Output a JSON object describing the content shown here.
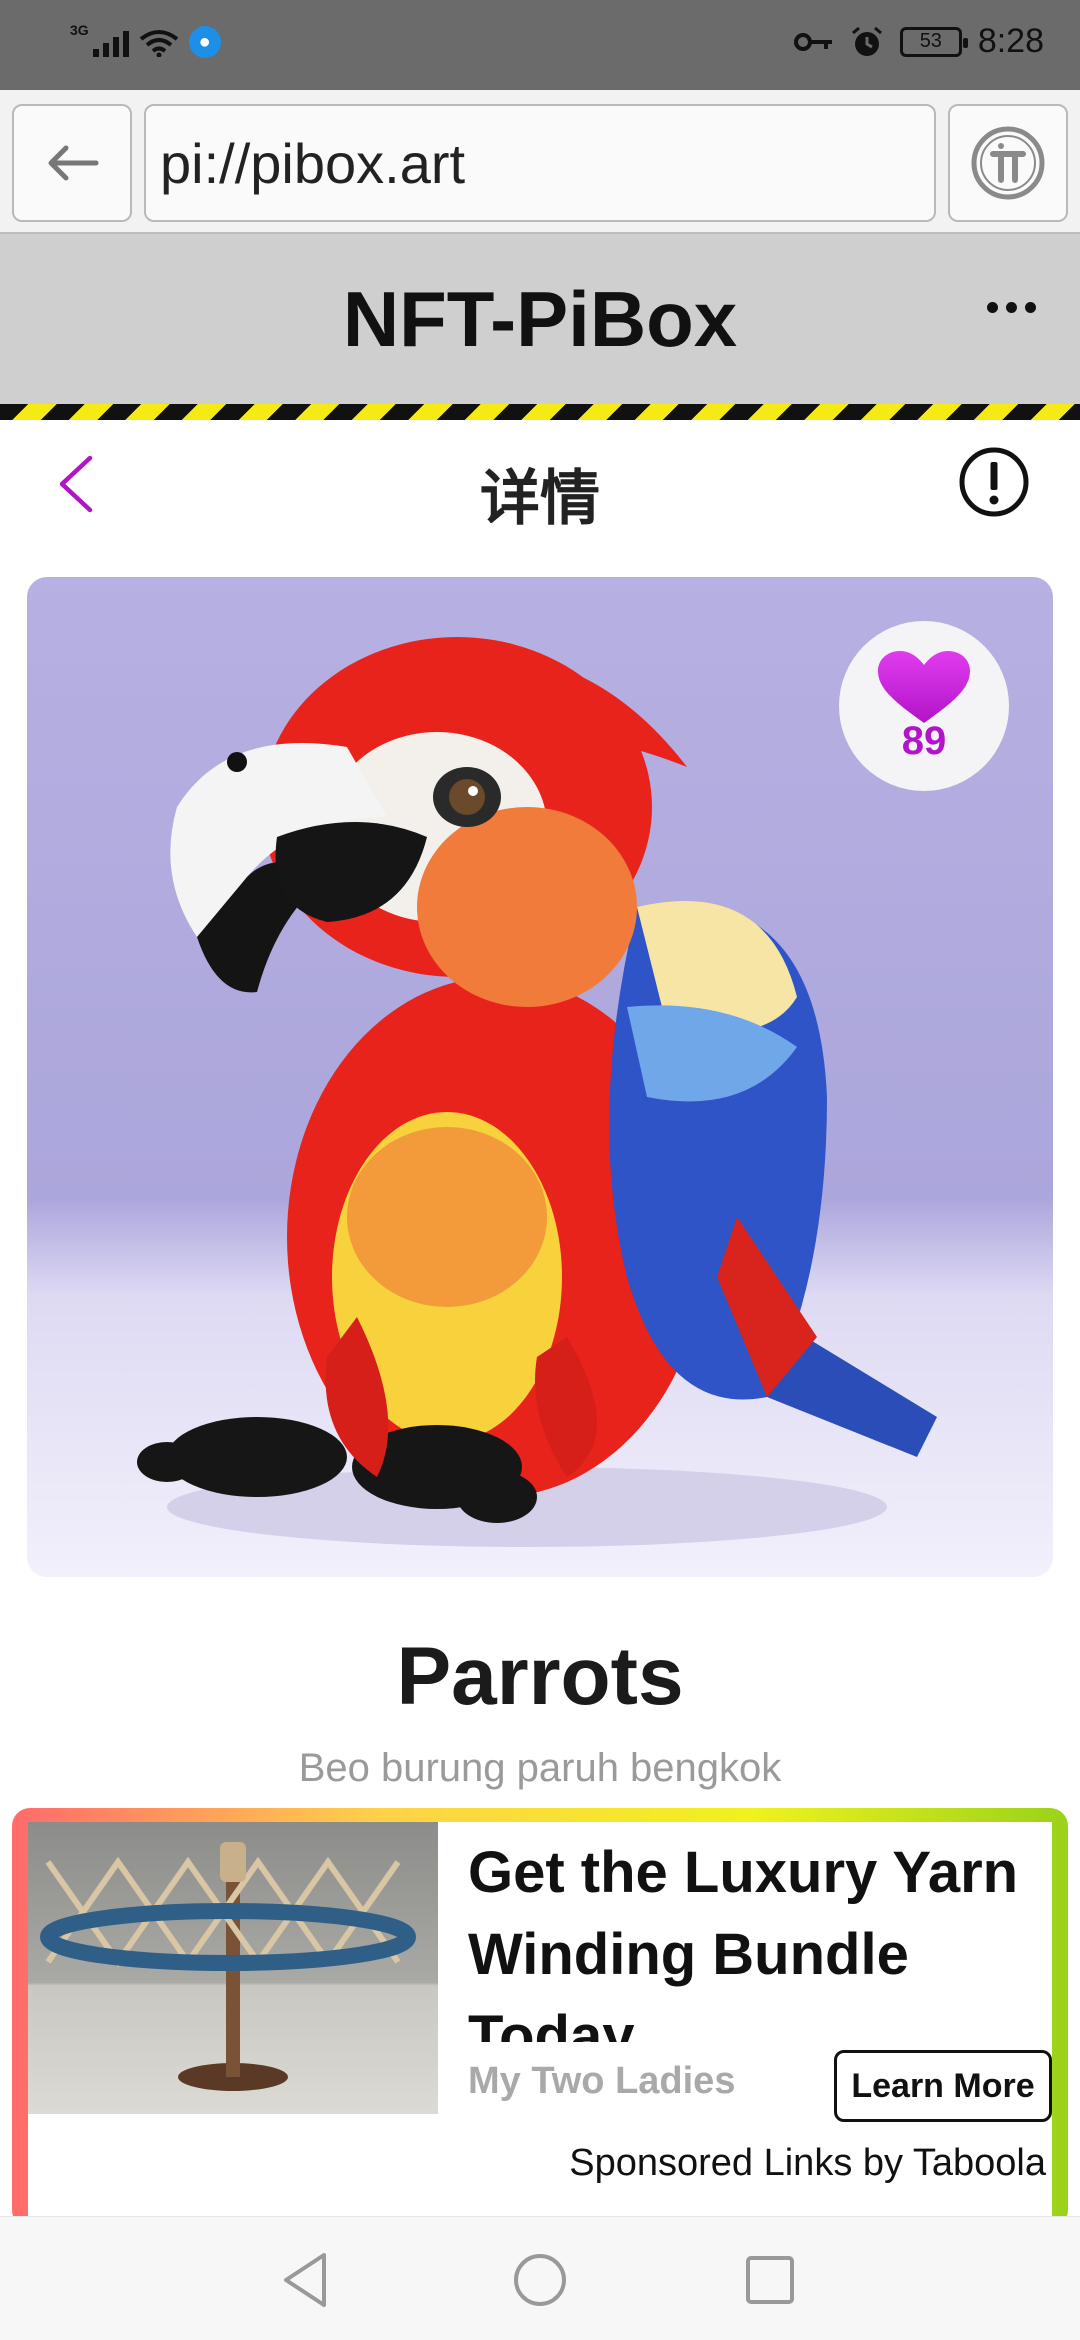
{
  "status_bar": {
    "network_type": "3G",
    "battery": "53",
    "time": "8:28",
    "icons": [
      "signal-icon",
      "wifi-icon",
      "app-notification-icon",
      "key-icon",
      "alarm-icon",
      "battery-icon"
    ]
  },
  "browser": {
    "url": "pi://pibox.art",
    "icons": [
      "back-arrow-icon",
      "pi-logo-icon"
    ]
  },
  "app_header": {
    "title": "NFT-PiBox",
    "more_icon": "more-dots-icon"
  },
  "detail": {
    "title": "详情",
    "back_icon": "chevron-left-icon",
    "info_icon": "info-icon",
    "accent_color": "#b214c8"
  },
  "nft": {
    "image": "plush-parrot-image",
    "like_count": "89",
    "like_icon": "heart-icon",
    "name": "Parrots",
    "description": "Beo burung paruh bengkok"
  },
  "ad": {
    "headline": "Get the Luxury Yarn Winding Bundle Today",
    "brand": "My Two Ladies",
    "cta": "Learn More",
    "sponsor": "Sponsored Links by Taboola",
    "image": "yarn-winder-image"
  },
  "nav_bar": {
    "icons": [
      "nav-back-icon",
      "nav-home-icon",
      "nav-recents-icon"
    ]
  }
}
